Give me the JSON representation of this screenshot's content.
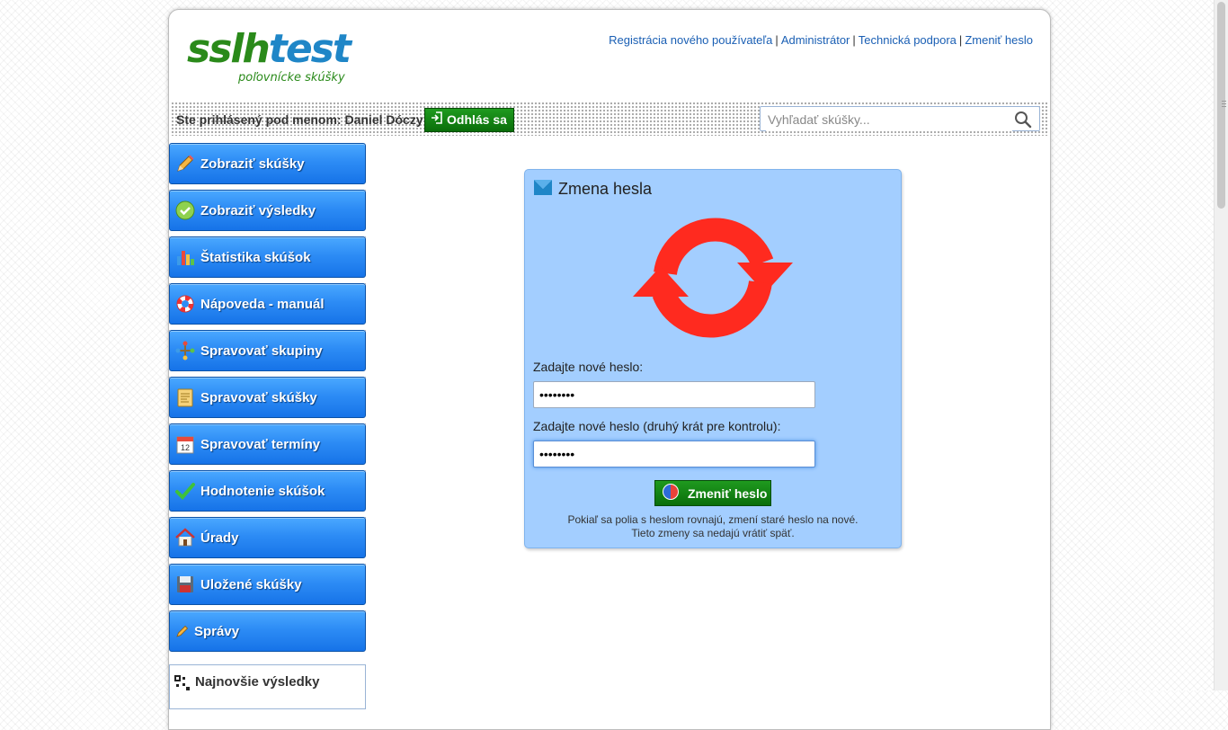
{
  "logo": {
    "part1": "sslh",
    "part2": "test",
    "subtitle": "poľovnícke skúšky"
  },
  "toplinks": [
    "Registrácia nového používateľa",
    "Administrátor",
    "Technická podpora",
    "Zmeniť heslo"
  ],
  "user": {
    "logged_in_text": "Ste prihlásený pod menom: Daniel Dóczy",
    "logout_label": "Odhlás sa"
  },
  "search": {
    "placeholder": "Vyhľadať skúšky..."
  },
  "sidebar": {
    "items": [
      {
        "label": "Zobraziť skúšky",
        "icon": "pencil-icon"
      },
      {
        "label": "Zobraziť výsledky",
        "icon": "check-circle-icon"
      },
      {
        "label": "Štatistika skúšok",
        "icon": "bar-chart-icon"
      },
      {
        "label": "Nápoveda - manuál",
        "icon": "lifebuoy-icon"
      },
      {
        "label": "Spravovať skupiny",
        "icon": "network-icon"
      },
      {
        "label": "Spravovať skúšky",
        "icon": "notepad-icon"
      },
      {
        "label": "Spravovať termíny",
        "icon": "calendar-icon"
      },
      {
        "label": "Hodnotenie skúšok",
        "icon": "checkmark-icon"
      },
      {
        "label": "Úrady",
        "icon": "home-icon"
      },
      {
        "label": "Uložené skúšky",
        "icon": "floppy-icon"
      },
      {
        "label": "Správy",
        "icon": "pen-icon"
      }
    ],
    "latest_label": "Najnovšie výsledky",
    "calendar_day": "12"
  },
  "panel": {
    "title": "Zmena hesla",
    "new_password_label": "Zadajte nové heslo:",
    "new_password_value": "••••••••",
    "confirm_label": "Zadajte nové heslo (druhý krát pre kontrolu):",
    "confirm_value": "••••••••",
    "submit_label": "Zmeniť heslo",
    "note": "Pokiaľ sa polia s heslom rovnajú, zmení staré heslo na nové. Tieto zmeny sa nedajú vrátiť späť."
  },
  "colors": {
    "brand_green": "#2a8a1a",
    "brand_blue": "#1f86c7",
    "menu_blue": "#2d8cf5",
    "panel_bg": "#a3ceff",
    "button_green": "#0a6e0a",
    "sync_red": "#ff2a1f"
  }
}
